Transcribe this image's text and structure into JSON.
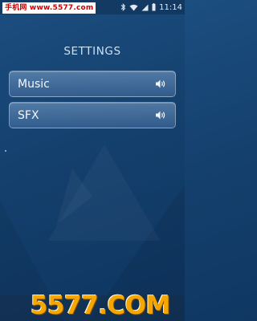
{
  "status_bar": {
    "time": "11:14",
    "icons": [
      "bluetooth-icon",
      "wifi-icon",
      "signal-icon",
      "battery-icon"
    ]
  },
  "watermark_top": "手机网 www.5577.com",
  "settings": {
    "title": "SETTINGS",
    "items": [
      {
        "label": "Music",
        "icon": "speaker-icon"
      },
      {
        "label": "SFX",
        "icon": "speaker-icon"
      }
    ]
  },
  "watermark_bottom": "5577.COM",
  "colors": {
    "background": "#174674",
    "row_fill": "#6f95c3",
    "watermark_red": "#d10000",
    "watermark_orange": "#f5a600"
  }
}
